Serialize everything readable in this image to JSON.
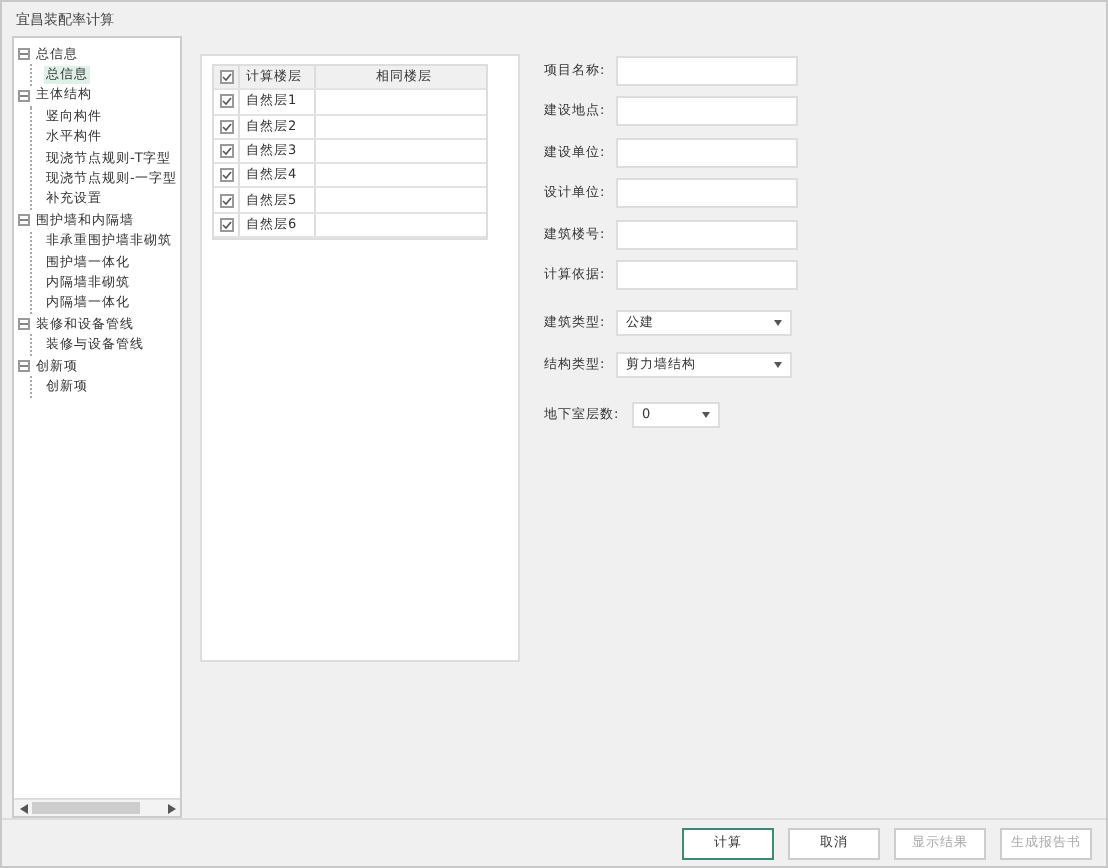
{
  "window": {
    "title": "宜昌装配率计算"
  },
  "tree": [
    {
      "label": "总信息",
      "expanded": true,
      "children": [
        {
          "label": "总信息",
          "selected": true
        }
      ]
    },
    {
      "label": "主体结构",
      "expanded": true,
      "children": [
        {
          "label": "竖向构件",
          "selected": false
        },
        {
          "label": "水平构件",
          "selected": false
        },
        {
          "label": "现浇节点规则-T字型",
          "selected": false
        },
        {
          "label": "现浇节点规则-一字型",
          "selected": false
        },
        {
          "label": "补充设置",
          "selected": false
        }
      ]
    },
    {
      "label": "围护墙和内隔墙",
      "expanded": true,
      "children": [
        {
          "label": "非承重围护墙非砌筑",
          "selected": false
        },
        {
          "label": "围护墙一体化",
          "selected": false
        },
        {
          "label": "内隔墙非砌筑",
          "selected": false
        },
        {
          "label": "内隔墙一体化",
          "selected": false
        }
      ]
    },
    {
      "label": "装修和设备管线",
      "expanded": true,
      "children": [
        {
          "label": "装修与设备管线",
          "selected": false
        }
      ]
    },
    {
      "label": "创新项",
      "expanded": true,
      "children": [
        {
          "label": "创新项",
          "selected": false
        }
      ]
    }
  ],
  "floors": {
    "header_checked": true,
    "columns": [
      "计算楼层",
      "相同楼层"
    ],
    "rows": [
      {
        "name": "自然层1",
        "checked": true
      },
      {
        "name": "自然层2",
        "checked": true
      },
      {
        "name": "自然层3",
        "checked": true
      },
      {
        "name": "自然层4",
        "checked": true
      },
      {
        "name": "自然层5",
        "checked": true
      },
      {
        "name": "自然层6",
        "checked": true
      }
    ]
  },
  "form": [
    {
      "kind": "text",
      "label": "项目名称:"
    },
    {
      "kind": "text",
      "label": "建设地点:"
    },
    {
      "kind": "text",
      "label": "建设单位:"
    },
    {
      "kind": "text",
      "label": "设计单位:"
    },
    {
      "kind": "text",
      "label": "建筑楼号:"
    },
    {
      "kind": "text",
      "label": "计算依据:"
    },
    {
      "kind": "select",
      "label": "建筑类型:",
      "value": "公建"
    },
    {
      "kind": "select",
      "label": "结构类型:",
      "value": "剪力墙结构"
    },
    {
      "kind": "small",
      "label": "地下室层数:",
      "value": "0"
    }
  ],
  "buttons": [
    {
      "label": "计算",
      "disabled": false,
      "default": true
    },
    {
      "label": "取消",
      "disabled": false,
      "default": false
    },
    {
      "label": "显示结果",
      "disabled": true,
      "default": false
    },
    {
      "label": "生成报告书",
      "disabled": true,
      "default": false
    }
  ]
}
